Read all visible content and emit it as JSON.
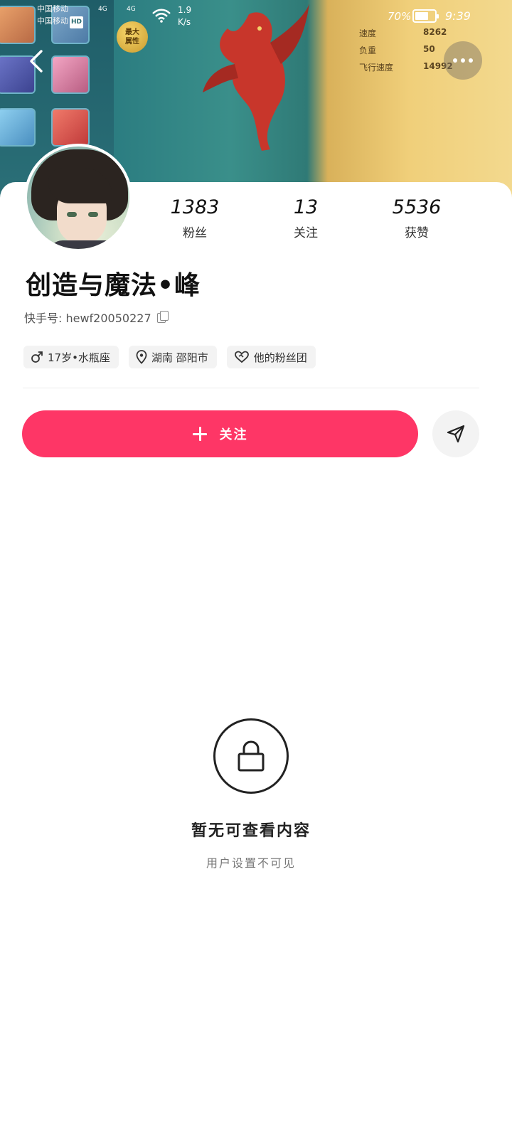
{
  "status_bar": {
    "carrier_1": "中国移动",
    "carrier_2": "中国移动",
    "hd_badge": "HD",
    "network_1": "4G",
    "network_2": "4G",
    "net_speed_value": "1.9",
    "net_speed_unit": "K/s",
    "battery_percent": "70%",
    "battery_level": 0.7,
    "time": "9:39"
  },
  "cover": {
    "badge_text_1": "最大",
    "badge_text_2": "属性",
    "stats": [
      {
        "label": "速度",
        "value": "8262"
      },
      {
        "label": "负重",
        "value": "50"
      },
      {
        "label": "飞行速度",
        "value": "14992"
      }
    ]
  },
  "profile": {
    "fans_count": "1383",
    "fans_label": "粉丝",
    "following_count": "13",
    "following_label": "关注",
    "likes_count": "5536",
    "likes_label": "获赞",
    "nickname": "创造与魔法•峰",
    "kwai_id": "快手号: hewf20050227",
    "tags": {
      "age_zodiac": "17岁•水瓶座",
      "location": "湖南 邵阳市",
      "fan_group": "他的粉丝团"
    }
  },
  "actions": {
    "follow_label": "关注"
  },
  "empty_state": {
    "title": "暂无可查看内容",
    "subtitle": "用户设置不可见"
  },
  "colors": {
    "accent": "#fe3666",
    "chip_bg": "#f3f3f3"
  }
}
